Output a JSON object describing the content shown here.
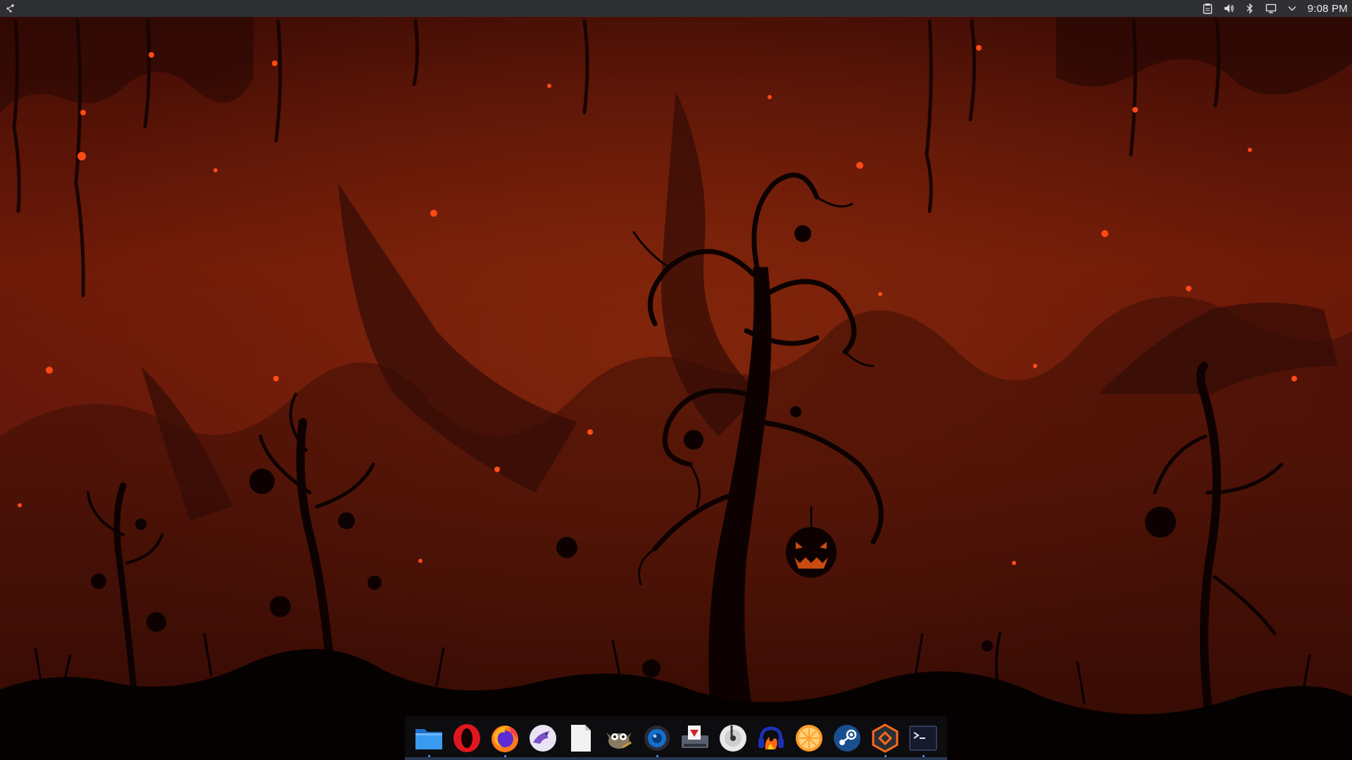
{
  "panel": {
    "clock": "9:08 PM",
    "launcher_icon": "kde-launcher-icon",
    "tray": [
      {
        "name": "clipboard-icon"
      },
      {
        "name": "volume-icon"
      },
      {
        "name": "bluetooth-icon"
      },
      {
        "name": "display-icon"
      },
      {
        "name": "chevron-down-icon"
      }
    ]
  },
  "colors": {
    "panel_bg": "#2f3033",
    "sky_top": "#4a0d05",
    "sky_mid": "#7a1c09",
    "ground": "#050101",
    "ember": "#ff4a14"
  },
  "dock": {
    "apps": [
      {
        "name": "file-manager-icon",
        "running": true
      },
      {
        "name": "opera-icon",
        "running": false
      },
      {
        "name": "firefox-icon",
        "running": true
      },
      {
        "name": "mail-eagle-icon",
        "running": false
      },
      {
        "name": "text-editor-icon",
        "running": false
      },
      {
        "name": "gimp-icon",
        "running": false
      },
      {
        "name": "camera-icon",
        "running": true
      },
      {
        "name": "pdf-tool-icon",
        "running": false
      },
      {
        "name": "music-disc-icon",
        "running": false
      },
      {
        "name": "audio-fire-icon",
        "running": false
      },
      {
        "name": "orange-icon",
        "running": false
      },
      {
        "name": "steam-icon",
        "running": false
      },
      {
        "name": "hexagon-app-icon",
        "running": true
      },
      {
        "name": "terminal-icon",
        "running": true
      }
    ]
  }
}
